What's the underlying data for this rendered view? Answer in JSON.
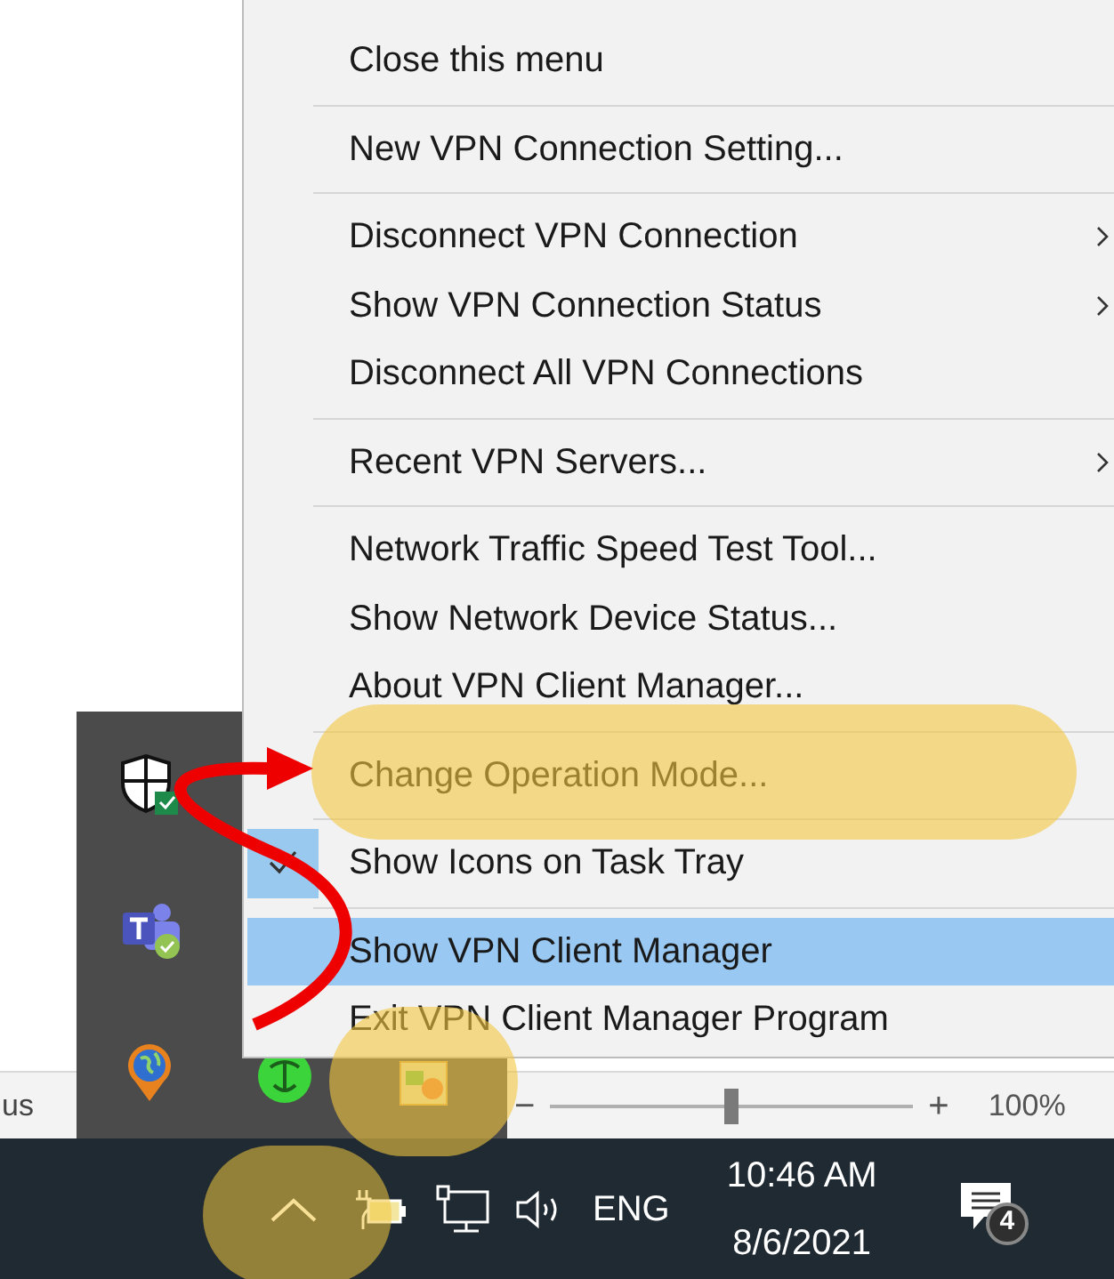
{
  "menu": {
    "groups": [
      [
        {
          "label": "Close this menu",
          "submenu": false,
          "checked": false,
          "selected": false
        }
      ],
      [
        {
          "label": "New VPN Connection Setting...",
          "submenu": false,
          "checked": false,
          "selected": false
        }
      ],
      [
        {
          "label": "Disconnect VPN Connection",
          "submenu": true,
          "checked": false,
          "selected": false
        },
        {
          "label": "Show VPN Connection Status",
          "submenu": true,
          "checked": false,
          "selected": false
        },
        {
          "label": "Disconnect All VPN Connections",
          "submenu": false,
          "checked": false,
          "selected": false
        }
      ],
      [
        {
          "label": "Recent VPN Servers...",
          "submenu": true,
          "checked": false,
          "selected": false
        }
      ],
      [
        {
          "label": "Network Traffic Speed Test Tool...",
          "submenu": false,
          "checked": false,
          "selected": false
        },
        {
          "label": "Show Network Device Status...",
          "submenu": false,
          "checked": false,
          "selected": false
        },
        {
          "label": "About VPN Client Manager...",
          "submenu": false,
          "checked": false,
          "selected": false
        }
      ],
      [
        {
          "label": "Change Operation Mode...",
          "submenu": false,
          "checked": false,
          "selected": false
        }
      ],
      [
        {
          "label": "Show Icons on Task Tray",
          "submenu": false,
          "checked": true,
          "selected": false
        }
      ],
      [
        {
          "label": "Show VPN Client Manager",
          "submenu": false,
          "checked": false,
          "selected": true
        },
        {
          "label": "Exit VPN Client Manager Program",
          "submenu": false,
          "checked": false,
          "selected": false
        }
      ]
    ]
  },
  "status_bar": {
    "text_fragment": "us",
    "zoom_out": "−",
    "zoom_in": "+",
    "zoom": {
      "level": 0.5
    },
    "zoom_reading": "100%"
  },
  "taskbar": {
    "language": "ENG",
    "time": "10:46 AM",
    "date": "8/6/2021",
    "notification_count": "4"
  }
}
